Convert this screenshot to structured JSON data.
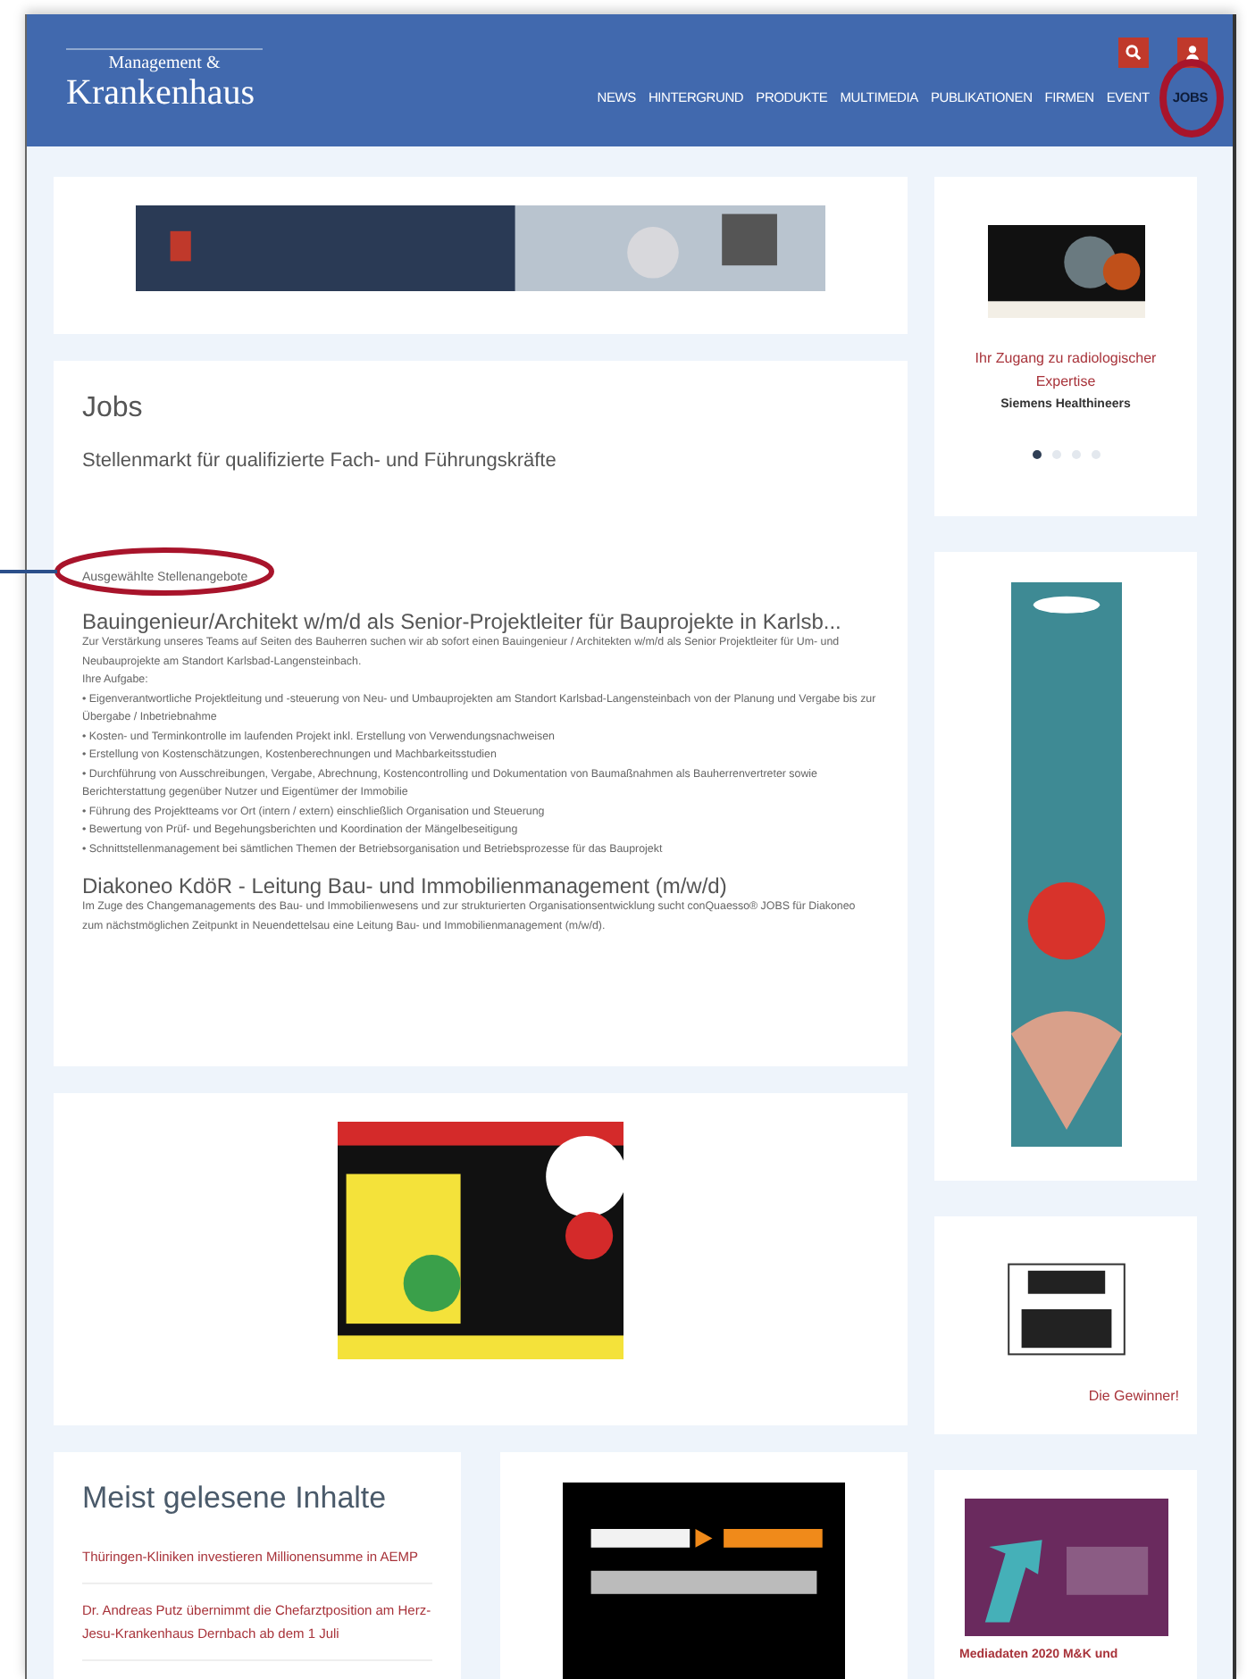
{
  "header": {
    "logo_small": "Management &",
    "logo_large": "Krankenhaus",
    "nav": [
      {
        "label": "NEWS",
        "selected": false
      },
      {
        "label": "HINTERGRUND",
        "selected": false
      },
      {
        "label": "PRODUKTE",
        "selected": false
      },
      {
        "label": "MULTIMEDIA",
        "selected": false
      },
      {
        "label": "PUBLIKATIONEN",
        "selected": false
      },
      {
        "label": "FIRMEN",
        "selected": false
      },
      {
        "label": "EVENT",
        "selected": false
      },
      {
        "label": "JOBS",
        "selected": true
      }
    ]
  },
  "jobs": {
    "title": "Jobs",
    "subtitle": "Stellenmarkt für qualifizierte Fach- und Führungskräfte",
    "section_label": "Ausgewählte Stellenangebote",
    "listings": [
      {
        "title": "Bauingenieur/Architekt w/m/d als Senior-Projektleiter für Bauprojekte in Karlsb...",
        "lines": [
          "Zur Verstärkung unseres Teams auf Seiten des Bauherren suchen wir ab sofort einen Bauingenieur / Architekten w/m/d als Senior Projektleiter für Um- und Neubauprojekte am Standort Karlsbad-Langensteinbach.",
          "Ihre Aufgabe:",
          "• Eigenverantwortliche Projektleitung und -steuerung von Neu- und Umbauprojekten am Standort Karlsbad-Langensteinbach von der Planung und Vergabe bis zur Übergabe / Inbetriebnahme",
          "• Kosten- und Terminkontrolle im laufenden Projekt inkl. Erstellung von Verwendungsnachweisen",
          "• Erstellung von Kostenschätzungen, Kostenberechnungen und Machbarkeitsstudien",
          "• Durchführung von Ausschreibungen, Vergabe, Abrechnung, Kostencontrolling und Dokumentation von Baumaßnahmen als Bauherrenvertreter sowie Berichterstattung gegenüber Nutzer und Eigentümer der Immobilie",
          "• Führung des Projektteams vor Ort (intern / extern) einschließlich Organisation und Steuerung",
          "• Bewertung von Prüf- und Begehungsberichten und Koordination der Mängelbeseitigung",
          "• Schnittstellenmanagement bei sämtlichen Themen der Betriebsorganisation und Betriebsprozesse für das Bauprojekt"
        ]
      },
      {
        "title": "Diakoneo KdöR - Leitung Bau- und Immobilienmanagement (m/w/d)",
        "lines": [
          "Im Zuge des Changemanagements des Bau- und Immobilienwesens und zur strukturierten Organisationsentwicklung sucht conQuaesso® JOBS für Diakoneo zum nächstmöglichen Zeitpunkt in Neuendettelsau eine Leitung Bau- und Immobilienmanagement (m/w/d)."
        ]
      }
    ]
  },
  "most_read": {
    "title": "Meist gelesene Inhalte",
    "items": [
      "Thüringen-Kliniken investieren Millionensumme in AEMP",
      "Dr. Andreas Putz übernimmt die Chefarztposition am Herz-Jesu-Krankenhaus Dernbach ab dem 1 Juli"
    ]
  },
  "sidebar": {
    "teaser": {
      "link": "Ihr Zugang zu radiologischer Expertise",
      "source": "Siemens Healthineers",
      "dots": [
        {
          "selected": true
        },
        {
          "selected": false
        },
        {
          "selected": false
        },
        {
          "selected": false
        }
      ]
    },
    "award_link": "Die Gewinner!",
    "media_link": "Mediadaten 2020 M&K und"
  }
}
